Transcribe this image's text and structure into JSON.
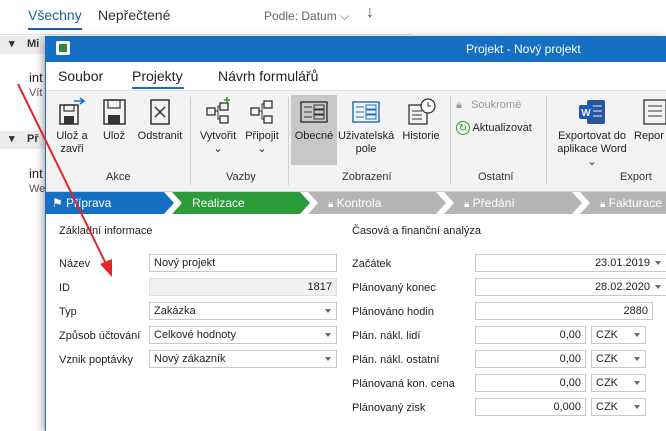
{
  "background_list": {
    "tabs": [
      "Všechny",
      "Nepřečtené"
    ],
    "sort_label": "Podle: Datum",
    "groups": [
      {
        "label": "Mi"
      },
      {
        "label": "Př"
      }
    ],
    "items": [
      {
        "line1": "int",
        "line2": "Vít"
      },
      {
        "line1": "int",
        "line2": "We"
      }
    ]
  },
  "window": {
    "title": "Projekt - Nový projekt"
  },
  "menu": {
    "items": [
      "Soubor",
      "Projekty",
      "Návrh formulářů"
    ]
  },
  "ribbon": {
    "buttons": {
      "uloz_zavri": "Ulož a zavři",
      "uloz": "Ulož",
      "odstranit": "Odstranit",
      "vytvorit": "Vytvořit",
      "pripojit": "Připojit",
      "obecne": "Obecné",
      "uzivatelska_pole": "Uživatelská pole",
      "historie": "Historie",
      "soukrome": "Soukromé",
      "aktualizovat": "Aktualizovat",
      "export_word": "Exportovat do aplikace Word",
      "report": "Repor"
    },
    "groups": [
      "Akce",
      "Vazby",
      "Zobrazení",
      "Ostatní",
      "Export"
    ]
  },
  "stages": [
    "Příprava",
    "Realizace",
    "Kontrola",
    "Předání",
    "Fakturace"
  ],
  "form": {
    "left_section": "Základní informace",
    "right_section": "Časová a finanční analýza",
    "left_fields": [
      {
        "label": "Název",
        "value": "Nový projekt"
      },
      {
        "label": "ID",
        "value": "1817"
      },
      {
        "label": "Typ",
        "value": "Zakázka"
      },
      {
        "label": "Způsob účtování",
        "value": "Celkové hodnoty"
      },
      {
        "label": "Vznik poptávky",
        "value": "Nový zákazník"
      }
    ],
    "right_fields": [
      {
        "label": "Začátek",
        "value": "23.01.2019"
      },
      {
        "label": "Plánovaný konec",
        "value": "28.02.2020"
      },
      {
        "label": "Plánováno hodin",
        "value": "2880"
      },
      {
        "label": "Plán. nákl. lidí",
        "value": "0,00",
        "currency": "CZK"
      },
      {
        "label": "Plán. nákl. ostatní",
        "value": "0,00",
        "currency": "CZK"
      },
      {
        "label": "Plánovaná kon. cena",
        "value": "0,00",
        "currency": "CZK"
      },
      {
        "label": "Plánovaný zisk",
        "value": "0,000",
        "currency": "CZK"
      }
    ]
  },
  "colors": {
    "accent": "#1570c3",
    "stage_active": "#2c9b3a",
    "stage_inactive": "#b5b5b5",
    "annotation_arrow": "#e0262a"
  }
}
